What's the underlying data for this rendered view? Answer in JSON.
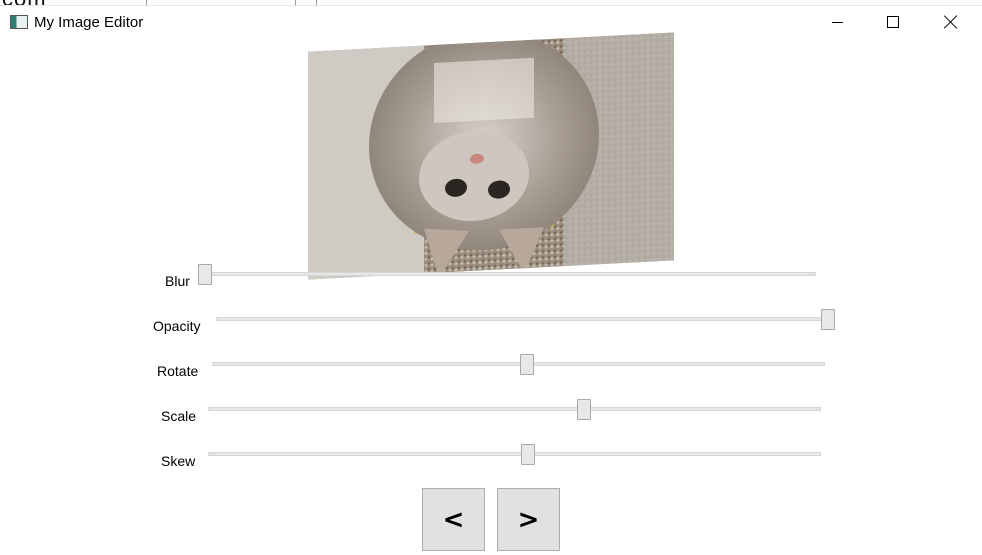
{
  "window": {
    "title": "My Image Editor",
    "background_text": "com"
  },
  "sliders": [
    {
      "label": "Blur",
      "value": 0.0
    },
    {
      "label": "Opacity",
      "value": 1.0
    },
    {
      "label": "Rotate",
      "value": 0.51
    },
    {
      "label": "Scale",
      "value": 0.61
    },
    {
      "label": "Skew",
      "value": 0.52
    }
  ],
  "buttons": {
    "prev_label": "<",
    "next_label": ">"
  },
  "colors": {
    "button_bg": "#e1e1e1",
    "track": "#e7e7e7",
    "thumb": "#e8e8e8"
  }
}
